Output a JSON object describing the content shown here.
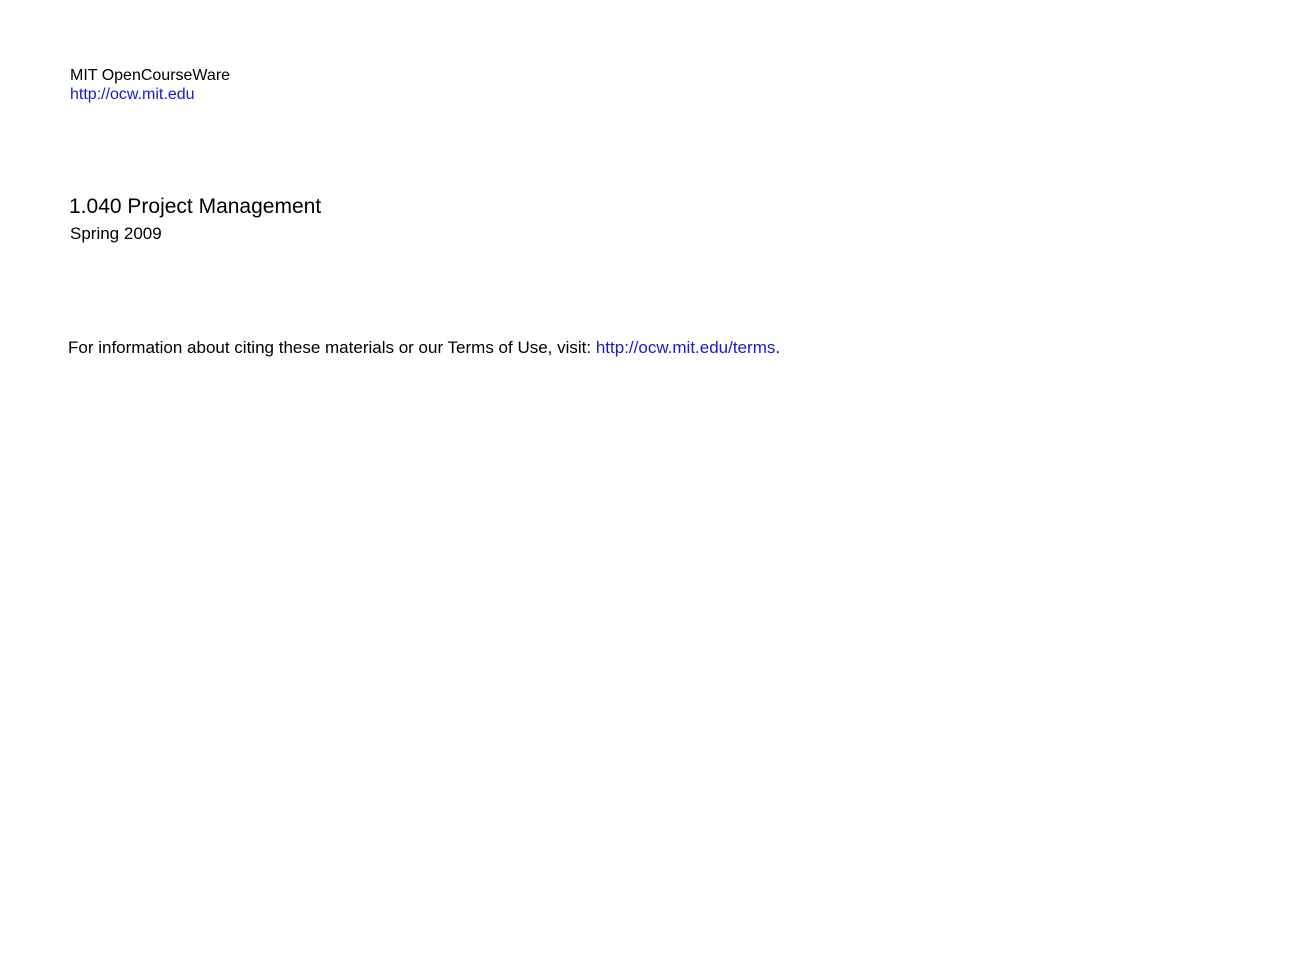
{
  "header": {
    "org_name": "MIT OpenCourseWare",
    "org_url": "http://ocw.mit.edu"
  },
  "course": {
    "title": "1.040 Project Management",
    "term": "Spring 2009"
  },
  "terms": {
    "text": "For information about citing these materials or our Terms of Use, visit: ",
    "link": "http://ocw.mit.edu/terms",
    "suffix": "."
  },
  "colors": {
    "link": "#1a1acc",
    "text": "#000000",
    "background": "#ffffff"
  }
}
